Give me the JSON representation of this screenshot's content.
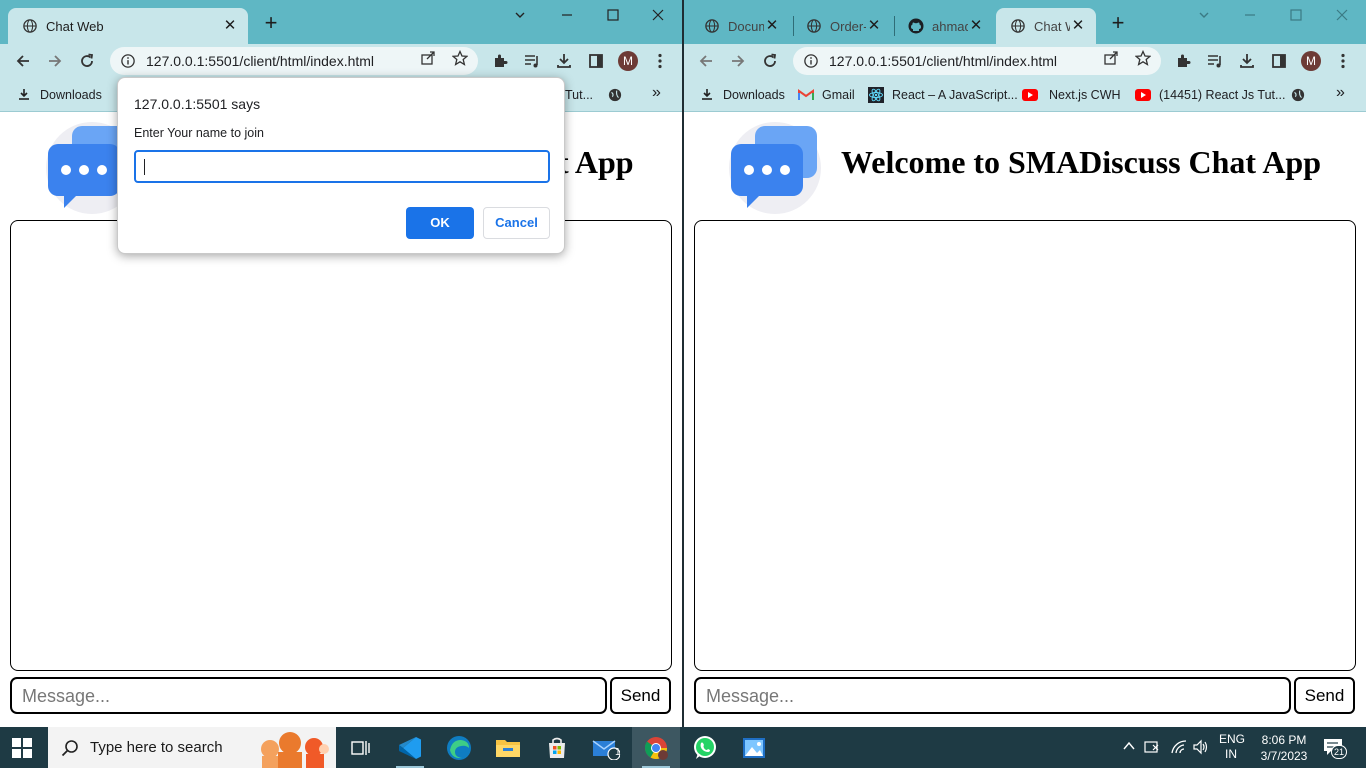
{
  "left_window": {
    "tabs": [
      {
        "title": "Chat Web",
        "active": true
      }
    ],
    "address": {
      "host": "127.0.0.1",
      "port_path": ":5501/client/html/index.html"
    },
    "avatar_letter": "M",
    "bookmarks": [
      {
        "label": "Downloads",
        "icon": "download-icon"
      },
      {
        "label": "Tut...",
        "icon": "youtube-icon"
      }
    ],
    "page": {
      "heading_visible": "t App",
      "message_placeholder": "Message...",
      "send_label": "Send"
    }
  },
  "right_window": {
    "tabs": [
      {
        "title": "Docum",
        "icon": "globe-icon",
        "active": false
      },
      {
        "title": "Order-",
        "icon": "globe-icon",
        "active": false
      },
      {
        "title": "ahmad",
        "icon": "github-icon",
        "active": false
      },
      {
        "title": "Chat W",
        "icon": "globe-icon",
        "active": true
      }
    ],
    "address": {
      "host": "127.0.0.1",
      "port_path": ":5501/client/html/index.html"
    },
    "avatar_letter": "M",
    "bookmarks": [
      {
        "label": "Downloads",
        "icon": "download-icon"
      },
      {
        "label": "Gmail",
        "icon": "gmail-icon"
      },
      {
        "label": "React – A JavaScript...",
        "icon": "react-icon"
      },
      {
        "label": "Next.js CWH",
        "icon": "youtube-icon"
      },
      {
        "label": "(14451) React Js Tut...",
        "icon": "youtube-icon"
      }
    ],
    "page": {
      "heading": "Welcome to SMADiscuss Chat App",
      "message_placeholder": "Message...",
      "send_label": "Send"
    }
  },
  "dialog": {
    "title": "127.0.0.1:5501 says",
    "message": "Enter Your name to join",
    "input_value": "",
    "ok_label": "OK",
    "cancel_label": "Cancel"
  },
  "taskbar": {
    "search_placeholder": "Type here to search",
    "mail_badge": "1",
    "language": {
      "line1": "ENG",
      "line2": "IN"
    },
    "time": "8:06 PM",
    "date": "3/7/2023",
    "notification_count": "21"
  },
  "colors": {
    "tabstrip": "#5fb7c4",
    "toolbar": "#c8e6ea",
    "accent_blue": "#1a73e8",
    "taskbar": "#1e3a44"
  }
}
